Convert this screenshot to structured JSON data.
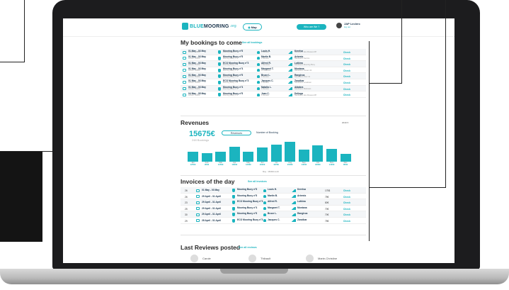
{
  "header": {
    "logo_blue": "BLUE",
    "logo_mooring": "MOORING",
    "logo_suffix": ".org",
    "map_label": "Map",
    "who_label": "Who are We ?",
    "user_name": "JAP Leclerc",
    "user_logout": "log out"
  },
  "bookings": {
    "title": "My bookings to come",
    "see_all": "See all bookings",
    "rows": [
      {
        "dates": "01 May - 03 May",
        "sub": "Arrival - 10AM",
        "boat": "Mooring Buoy n°6",
        "boat_sub": "Mooring Buoy n°6",
        "person": "Louis H.",
        "person_sub": "1 Review",
        "port": "Kerelsa",
        "port_sub": "Sardiniens des Musees RP",
        "check": "Check"
      },
      {
        "dates": "01 May - 03 May",
        "sub": "Arrival - 10AM",
        "boat": "Mooring Buoy n°6",
        "boat_sub": "Mooring Buoy n°6",
        "person": "Martin B.",
        "person_sub": "1 Review",
        "port": "Artemis",
        "port_sub": "Sardiniens Sud AL",
        "check": "Check"
      },
      {
        "dates": "01 May - 03 May",
        "sub": "Arrival - 10AM",
        "boat": "ECO Mooring Buoy n°3",
        "boat_sub": "Mooring Buoy n°3",
        "person": "Alfred R.",
        "person_sub": "7 Reviews",
        "port": "Lutkina",
        "port_sub": "Sardiniens Mooring Buoy",
        "check": "Check"
      },
      {
        "dates": "01 May - 03 May",
        "sub": "Arrival - 10AM",
        "boat": "Mooring Buoy n°4",
        "boat_sub": "Mooring Buoy n°4",
        "person": "Margaret T.",
        "person_sub": "12 Reviews",
        "port": "Montana",
        "port_sub": "Sardiniens Ocean 32",
        "check": "Check"
      },
      {
        "dates": "01 May - 03 May",
        "sub": "Arrival - 10AM",
        "boat": "Mooring Buoy n°6",
        "boat_sub": "Mooring Buoy n°6",
        "person": "Bruce L.",
        "person_sub": "1 Review",
        "port": "Rangiroa",
        "port_sub": "Sardiniens Pour 41",
        "check": "Check"
      },
      {
        "dates": "01 May - 03 May",
        "sub": "Arrival - 10AM",
        "boat": "ECO Mooring Buoy n°3",
        "boat_sub": "Mooring Buoy n°3",
        "person": "Jacques C.",
        "person_sub": "1 Review",
        "port": "Zanzibar",
        "port_sub": "Sardiniens Lowdown",
        "check": "Check"
      },
      {
        "dates": "01 May - 03 May",
        "sub": "Arrival - 10AM",
        "boat": "Mooring Buoy n°4",
        "boat_sub": "Mooring Buoy n°4",
        "person": "Natalia L.",
        "person_sub": "1 Review",
        "port": "Aldabra",
        "port_sub": "Sardiniens Malowan",
        "check": "Check"
      },
      {
        "dates": "04 May - 05 May",
        "sub": "Arrival - 10AM",
        "boat": "Mooring Buoy n°6",
        "boat_sub": "Mooring Buoy n°6",
        "person": "Jean C.",
        "person_sub": "1 Review",
        "port": "Delinga",
        "port_sub": "Sardiniens des Musees RP",
        "check": "Check"
      }
    ]
  },
  "revenues": {
    "title": "Revenues",
    "total": "15675€",
    "total_sub": "248 Bookings",
    "revenues_btn": "Revenues",
    "bookings_btn": "Number of Booking",
    "year": "2019",
    "month_label": "May : 1500€/month",
    "bar_color": "#1bb4bf"
  },
  "chart_data": {
    "type": "bar",
    "categories": [
      "Jan",
      "Feb",
      "Mar",
      "Apr",
      "May",
      "Jun",
      "Jul",
      "Aug",
      "Sep",
      "Oct",
      "Nov",
      "Dec"
    ],
    "values": [
      900,
      750,
      860,
      1350,
      900,
      1250,
      1500,
      1800,
      1100,
      1450,
      1150,
      700
    ],
    "value_labels": [
      "1250€",
      "950€",
      "1050€",
      "1840€",
      "1200€",
      "1600€",
      "1875€",
      "2000€",
      "1400€",
      "1800€",
      "1400€",
      "850€"
    ],
    "title": "Revenues",
    "ylim": [
      0,
      1900
    ]
  },
  "invoices": {
    "title": "Invoices of the day",
    "see_all": "See all invoices",
    "rows": [
      {
        "day": "26",
        "dates": "01 May - 03 May",
        "boat": "Mooring Buoy n°6",
        "person": "Louis H.",
        "port": "Kerelsa",
        "price": "175$",
        "check": "Check"
      },
      {
        "day": "26",
        "dates": "29 April - 31 April",
        "boat": "Mooring Buoy n°6",
        "person": "Martin B.",
        "port": "Artemis",
        "price": "75€",
        "check": "Check"
      },
      {
        "day": "23",
        "dates": "29 April - 31 April",
        "boat": "ECO Mooring Buoy n°3",
        "person": "Alfred R.",
        "port": "Lutkina",
        "price": "80€",
        "check": "Check"
      },
      {
        "day": "25",
        "dates": "29 April - 31 April",
        "boat": "Mooring Buoy n°4",
        "person": "Margaret T.",
        "port": "Montana",
        "price": "70€",
        "check": "Check"
      },
      {
        "day": "30",
        "dates": "29 April - 31 April",
        "boat": "Mooring Buoy n°6",
        "person": "Bruce L.",
        "port": "Rangiroa",
        "price": "70€",
        "check": "Check"
      },
      {
        "day": "29",
        "dates": "28 April - 31 April",
        "boat": "ECO Mooring Buoy n°3",
        "person": "Jacques C.",
        "port": "Zanzibar",
        "price": "75€",
        "check": "Check"
      }
    ]
  },
  "reviews": {
    "title": "Last Reviews posted",
    "see_all": "See all reviews",
    "people": [
      "Carole",
      "Thibault",
      "Marie-Christine"
    ]
  }
}
